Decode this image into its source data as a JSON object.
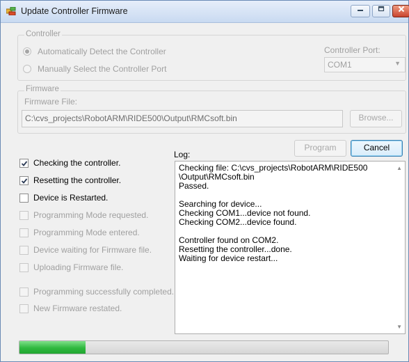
{
  "window": {
    "title": "Update Controller Firmware"
  },
  "controller": {
    "group_label": "Controller",
    "auto_detect_label": "Automatically Detect the Controller",
    "manual_select_label": "Manually Select the Controller Port",
    "selected_mode": "auto",
    "port_label": "Controller Port:",
    "port_value": "COM1"
  },
  "firmware": {
    "group_label": "Firmware",
    "file_label": "Firmware File:",
    "file_path": "C:\\cvs_projects\\RobotARM\\RIDE500\\Output\\RMCsoft.bin",
    "browse_label": "Browse..."
  },
  "actions": {
    "program_label": "Program",
    "cancel_label": "Cancel"
  },
  "steps": [
    {
      "label": "Checking the controller.",
      "checked": true,
      "enabled": true
    },
    {
      "label": "Resetting the controller.",
      "checked": true,
      "enabled": true
    },
    {
      "label": "Device is Restarted.",
      "checked": false,
      "enabled": true
    },
    {
      "label": "Programming Mode requested.",
      "checked": false,
      "enabled": false
    },
    {
      "label": "Programming Mode entered.",
      "checked": false,
      "enabled": false
    },
    {
      "label": "Device waiting for Firmware file.",
      "checked": false,
      "enabled": false
    },
    {
      "label": "Uploading Firmware file.",
      "checked": false,
      "enabled": false
    },
    {
      "label": "Programming successfully completed.",
      "checked": false,
      "enabled": false
    },
    {
      "label": "New Firmware restated.",
      "checked": false,
      "enabled": false
    }
  ],
  "log": {
    "label": "Log:",
    "text": "Checking file: C:\\cvs_projects\\RobotARM\\RIDE500\n\\Output\\RMCsoft.bin\nPassed.\n\nSearching for device...\nChecking COM1...device not found.\nChecking COM2...device found.\n\nController found on COM2.\nResetting the controller...done.\nWaiting for device restart..."
  },
  "progress": {
    "value": 0.18
  }
}
